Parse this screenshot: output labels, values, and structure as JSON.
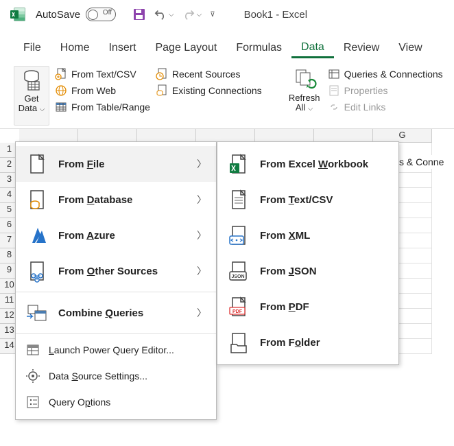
{
  "titlebar": {
    "autosave": "AutoSave",
    "toggle_state": "Off",
    "title": "Book1  -  Excel"
  },
  "tabs": [
    "File",
    "Home",
    "Insert",
    "Page Layout",
    "Formulas",
    "Data",
    "Review",
    "View"
  ],
  "active_tab": 5,
  "ribbon": {
    "getdata": {
      "line1": "Get",
      "line2": "Data"
    },
    "fromtextcsv": "From Text/CSV",
    "fromweb": "From Web",
    "fromtable": "From Table/Range",
    "recentsources": "Recent Sources",
    "existingconn": "Existing Connections",
    "refreshall": {
      "line1": "Refresh",
      "line2": "All"
    },
    "queries": "Queries & Connections",
    "properties": "Properties",
    "editlinks": "Edit Links"
  },
  "side_label": "s & Conne",
  "menu1": {
    "from_file": "From File",
    "from_database": "From Database",
    "from_azure": "From Azure",
    "from_other": "From Other Sources",
    "combine": "Combine Queries",
    "launch_pq": "Launch Power Query Editor...",
    "data_source": "Data Source Settings...",
    "query_options": "Query Options"
  },
  "menu2": {
    "excel_wb": "From Excel Workbook",
    "text_csv": "From Text/CSV",
    "xml": "From XML",
    "json": "From JSON",
    "pdf": "From PDF",
    "folder": "From Folder"
  },
  "visible_col": "G",
  "row_headers": [
    1,
    2,
    3,
    4,
    5,
    6,
    7,
    8,
    9,
    10,
    11,
    12,
    13,
    14
  ]
}
